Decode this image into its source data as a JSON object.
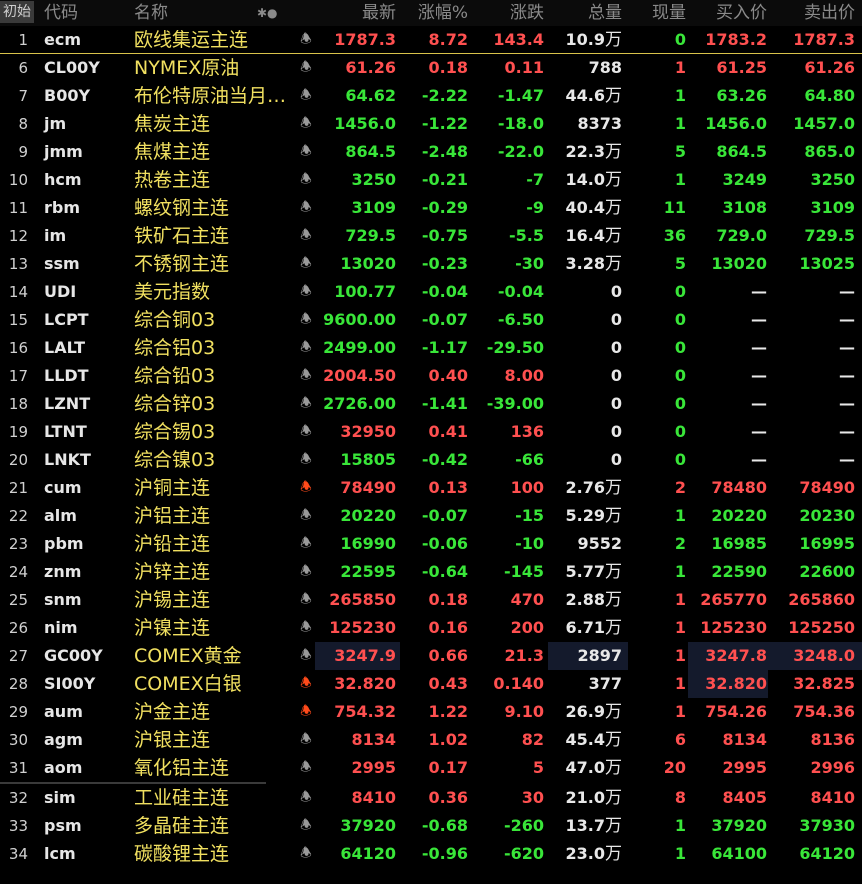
{
  "header": {
    "init_label": "初始",
    "cols": {
      "code": "代码",
      "name": "名称",
      "marker": "✱●",
      "last": "最新",
      "chgp": "涨幅%",
      "chg": "涨跌",
      "vol": "总量",
      "cur": "现量",
      "bid": "买入价",
      "ask": "卖出价"
    }
  },
  "colors": {
    "up": "#ff5050",
    "down": "#39e639",
    "name": "#f1e060",
    "alert_bell": "#ff4a1a"
  },
  "icons": {
    "bell": "bell-icon"
  },
  "rows": [
    {
      "idx": "1",
      "code": "ecm",
      "name": "欧线集运主连",
      "bell": "off",
      "last": "1787.3",
      "chgp": "8.72",
      "chg": "143.4",
      "vol": "10.9",
      "unit": "万",
      "cur": "0",
      "bid": "1783.2",
      "ask": "1787.3",
      "dir": "up"
    },
    {
      "idx": "6",
      "code": "CL00Y",
      "name": "NYMEX原油",
      "bell": "off",
      "last": "61.26",
      "chgp": "0.18",
      "chg": "0.11",
      "vol": "788",
      "unit": "",
      "cur": "1",
      "bid": "61.25",
      "ask": "61.26",
      "dir": "up"
    },
    {
      "idx": "7",
      "code": "B00Y",
      "name": "布伦特原油当月…",
      "bell": "off",
      "last": "64.62",
      "chgp": "-2.22",
      "chg": "-1.47",
      "vol": "44.6",
      "unit": "万",
      "cur": "1",
      "bid": "63.26",
      "ask": "64.80",
      "dir": "dn"
    },
    {
      "idx": "8",
      "code": "jm",
      "name": "焦炭主连",
      "bell": "off",
      "last": "1456.0",
      "chgp": "-1.22",
      "chg": "-18.0",
      "vol": "8373",
      "unit": "",
      "cur": "1",
      "bid": "1456.0",
      "ask": "1457.0",
      "dir": "dn"
    },
    {
      "idx": "9",
      "code": "jmm",
      "name": "焦煤主连",
      "bell": "off",
      "last": "864.5",
      "chgp": "-2.48",
      "chg": "-22.0",
      "vol": "22.3",
      "unit": "万",
      "cur": "5",
      "bid": "864.5",
      "ask": "865.0",
      "dir": "dn"
    },
    {
      "idx": "10",
      "code": "hcm",
      "name": "热卷主连",
      "bell": "off",
      "last": "3250",
      "chgp": "-0.21",
      "chg": "-7",
      "vol": "14.0",
      "unit": "万",
      "cur": "1",
      "bid": "3249",
      "ask": "3250",
      "dir": "dn"
    },
    {
      "idx": "11",
      "code": "rbm",
      "name": "螺纹钢主连",
      "bell": "off",
      "last": "3109",
      "chgp": "-0.29",
      "chg": "-9",
      "vol": "40.4",
      "unit": "万",
      "cur": "11",
      "bid": "3108",
      "ask": "3109",
      "dir": "dn"
    },
    {
      "idx": "12",
      "code": "im",
      "name": "铁矿石主连",
      "bell": "off",
      "last": "729.5",
      "chgp": "-0.75",
      "chg": "-5.5",
      "vol": "16.4",
      "unit": "万",
      "cur": "36",
      "bid": "729.0",
      "ask": "729.5",
      "dir": "dn"
    },
    {
      "idx": "13",
      "code": "ssm",
      "name": "不锈钢主连",
      "bell": "off",
      "last": "13020",
      "chgp": "-0.23",
      "chg": "-30",
      "vol": "3.28",
      "unit": "万",
      "cur": "5",
      "bid": "13020",
      "ask": "13025",
      "dir": "dn"
    },
    {
      "idx": "14",
      "code": "UDI",
      "name": "美元指数",
      "bell": "off",
      "last": "100.77",
      "chgp": "-0.04",
      "chg": "-0.04",
      "vol": "0",
      "unit": "",
      "cur": "0",
      "bid": "—",
      "ask": "—",
      "dir": "dn"
    },
    {
      "idx": "15",
      "code": "LCPT",
      "name": "综合铜03",
      "bell": "off",
      "last": "9600.00",
      "chgp": "-0.07",
      "chg": "-6.50",
      "vol": "0",
      "unit": "",
      "cur": "0",
      "bid": "—",
      "ask": "—",
      "dir": "dn"
    },
    {
      "idx": "16",
      "code": "LALT",
      "name": "综合铝03",
      "bell": "off",
      "last": "2499.00",
      "chgp": "-1.17",
      "chg": "-29.50",
      "vol": "0",
      "unit": "",
      "cur": "0",
      "bid": "—",
      "ask": "—",
      "dir": "dn"
    },
    {
      "idx": "17",
      "code": "LLDT",
      "name": "综合铅03",
      "bell": "off",
      "last": "2004.50",
      "chgp": "0.40",
      "chg": "8.00",
      "vol": "0",
      "unit": "",
      "cur": "0",
      "bid": "—",
      "ask": "—",
      "dir": "up"
    },
    {
      "idx": "18",
      "code": "LZNT",
      "name": "综合锌03",
      "bell": "off",
      "last": "2726.00",
      "chgp": "-1.41",
      "chg": "-39.00",
      "vol": "0",
      "unit": "",
      "cur": "0",
      "bid": "—",
      "ask": "—",
      "dir": "dn"
    },
    {
      "idx": "19",
      "code": "LTNT",
      "name": "综合锡03",
      "bell": "off",
      "last": "32950",
      "chgp": "0.41",
      "chg": "136",
      "vol": "0",
      "unit": "",
      "cur": "0",
      "bid": "—",
      "ask": "—",
      "dir": "up"
    },
    {
      "idx": "20",
      "code": "LNKT",
      "name": "综合镍03",
      "bell": "off",
      "last": "15805",
      "chgp": "-0.42",
      "chg": "-66",
      "vol": "0",
      "unit": "",
      "cur": "0",
      "bid": "—",
      "ask": "—",
      "dir": "dn"
    },
    {
      "idx": "21",
      "code": "cum",
      "name": "沪铜主连",
      "bell": "on",
      "last": "78490",
      "chgp": "0.13",
      "chg": "100",
      "vol": "2.76",
      "unit": "万",
      "cur": "2",
      "bid": "78480",
      "ask": "78490",
      "dir": "up"
    },
    {
      "idx": "22",
      "code": "alm",
      "name": "沪铝主连",
      "bell": "off",
      "last": "20220",
      "chgp": "-0.07",
      "chg": "-15",
      "vol": "5.29",
      "unit": "万",
      "cur": "1",
      "bid": "20220",
      "ask": "20230",
      "dir": "dn"
    },
    {
      "idx": "23",
      "code": "pbm",
      "name": "沪铅主连",
      "bell": "off",
      "last": "16990",
      "chgp": "-0.06",
      "chg": "-10",
      "vol": "9552",
      "unit": "",
      "cur": "2",
      "bid": "16985",
      "ask": "16995",
      "dir": "dn"
    },
    {
      "idx": "24",
      "code": "znm",
      "name": "沪锌主连",
      "bell": "off",
      "last": "22595",
      "chgp": "-0.64",
      "chg": "-145",
      "vol": "5.77",
      "unit": "万",
      "cur": "1",
      "bid": "22590",
      "ask": "22600",
      "dir": "dn"
    },
    {
      "idx": "25",
      "code": "snm",
      "name": "沪锡主连",
      "bell": "off",
      "last": "265850",
      "chgp": "0.18",
      "chg": "470",
      "vol": "2.88",
      "unit": "万",
      "cur": "1",
      "bid": "265770",
      "ask": "265860",
      "dir": "up"
    },
    {
      "idx": "26",
      "code": "nim",
      "name": "沪镍主连",
      "bell": "off",
      "last": "125230",
      "chgp": "0.16",
      "chg": "200",
      "vol": "6.71",
      "unit": "万",
      "cur": "1",
      "bid": "125230",
      "ask": "125250",
      "dir": "up"
    },
    {
      "idx": "27",
      "code": "GC00Y",
      "name": "COMEX黄金",
      "bell": "off",
      "last": "3247.9",
      "chgp": "0.66",
      "chg": "21.3",
      "vol": "2897",
      "unit": "",
      "cur": "1",
      "bid": "3247.8",
      "ask": "3248.0",
      "dir": "up",
      "hl": "gold"
    },
    {
      "idx": "28",
      "code": "SI00Y",
      "name": "COMEX白银",
      "bell": "on",
      "last": "32.820",
      "chgp": "0.43",
      "chg": "0.140",
      "vol": "377",
      "unit": "",
      "cur": "1",
      "bid": "32.820",
      "ask": "32.825",
      "dir": "up",
      "hl": "silver"
    },
    {
      "idx": "29",
      "code": "aum",
      "name": "沪金主连",
      "bell": "on",
      "last": "754.32",
      "chgp": "1.22",
      "chg": "9.10",
      "vol": "26.9",
      "unit": "万",
      "cur": "1",
      "bid": "754.26",
      "ask": "754.36",
      "dir": "up"
    },
    {
      "idx": "30",
      "code": "agm",
      "name": "沪银主连",
      "bell": "off",
      "last": "8134",
      "chgp": "1.02",
      "chg": "82",
      "vol": "45.4",
      "unit": "万",
      "cur": "6",
      "bid": "8134",
      "ask": "8136",
      "dir": "up"
    },
    {
      "idx": "31",
      "code": "aom",
      "name": "氧化铝主连",
      "bell": "off",
      "last": "2995",
      "chgp": "0.17",
      "chg": "5",
      "vol": "47.0",
      "unit": "万",
      "cur": "20",
      "bid": "2995",
      "ask": "2996",
      "dir": "up"
    },
    {
      "idx": "32",
      "code": "sim",
      "name": "工业硅主连",
      "bell": "off",
      "last": "8410",
      "chgp": "0.36",
      "chg": "30",
      "vol": "21.0",
      "unit": "万",
      "cur": "8",
      "bid": "8405",
      "ask": "8410",
      "dir": "up"
    },
    {
      "idx": "33",
      "code": "psm",
      "name": "多晶硅主连",
      "bell": "off",
      "last": "37920",
      "chgp": "-0.68",
      "chg": "-260",
      "vol": "13.7",
      "unit": "万",
      "cur": "1",
      "bid": "37920",
      "ask": "37930",
      "dir": "dn"
    },
    {
      "idx": "34",
      "code": "lcm",
      "name": "碳酸锂主连",
      "bell": "off",
      "last": "64120",
      "chgp": "-0.96",
      "chg": "-620",
      "vol": "23.0",
      "unit": "万",
      "cur": "1",
      "bid": "64100",
      "ask": "64120",
      "dir": "dn"
    }
  ]
}
